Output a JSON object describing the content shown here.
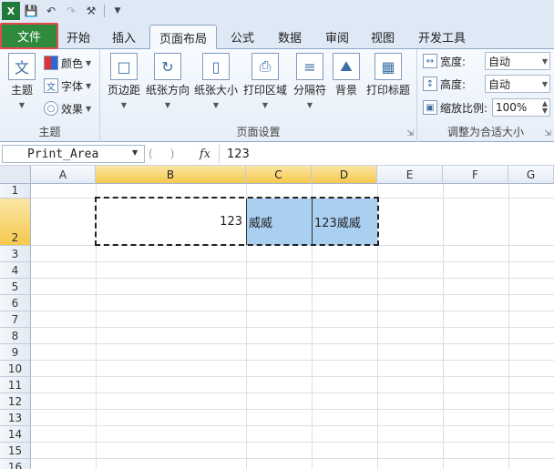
{
  "qat": {
    "icons": [
      "excel-logo-icon",
      "save-icon",
      "undo-icon",
      "redo-icon",
      "tools-icon",
      "customize-icon"
    ]
  },
  "tabs": [
    {
      "label": "文件"
    },
    {
      "label": "开始"
    },
    {
      "label": "插入"
    },
    {
      "label": "页面布局"
    },
    {
      "label": "公式"
    },
    {
      "label": "数据"
    },
    {
      "label": "审阅"
    },
    {
      "label": "视图"
    },
    {
      "label": "开发工具"
    }
  ],
  "ribbon": {
    "theme_group": {
      "label": "主题",
      "theme_button": "主题",
      "colors": "颜色",
      "fonts": "字体",
      "effects": "效果"
    },
    "page_setup_group": {
      "label": "页面设置",
      "buttons": [
        "页边距",
        "纸张方向",
        "纸张大小",
        "打印区域",
        "分隔符",
        "背景",
        "打印标题"
      ]
    },
    "scale_group": {
      "label": "调整为合适大小",
      "width_label": "宽度:",
      "width_value": "自动",
      "height_label": "高度:",
      "height_value": "自动",
      "scale_label": "缩放比例:",
      "scale_value": "100%"
    }
  },
  "formula_bar": {
    "name_box": "Print_Area",
    "fx": "fx",
    "formula": "123"
  },
  "grid": {
    "columns": [
      "A",
      "B",
      "C",
      "D",
      "E",
      "F",
      "G"
    ],
    "rows": [
      "1",
      "2",
      "3",
      "4",
      "5",
      "6",
      "7",
      "8",
      "9",
      "10",
      "11",
      "12",
      "13",
      "14",
      "15",
      "16"
    ],
    "cells": {
      "B2": "123",
      "C2": "威威",
      "D2": "123威威"
    }
  }
}
